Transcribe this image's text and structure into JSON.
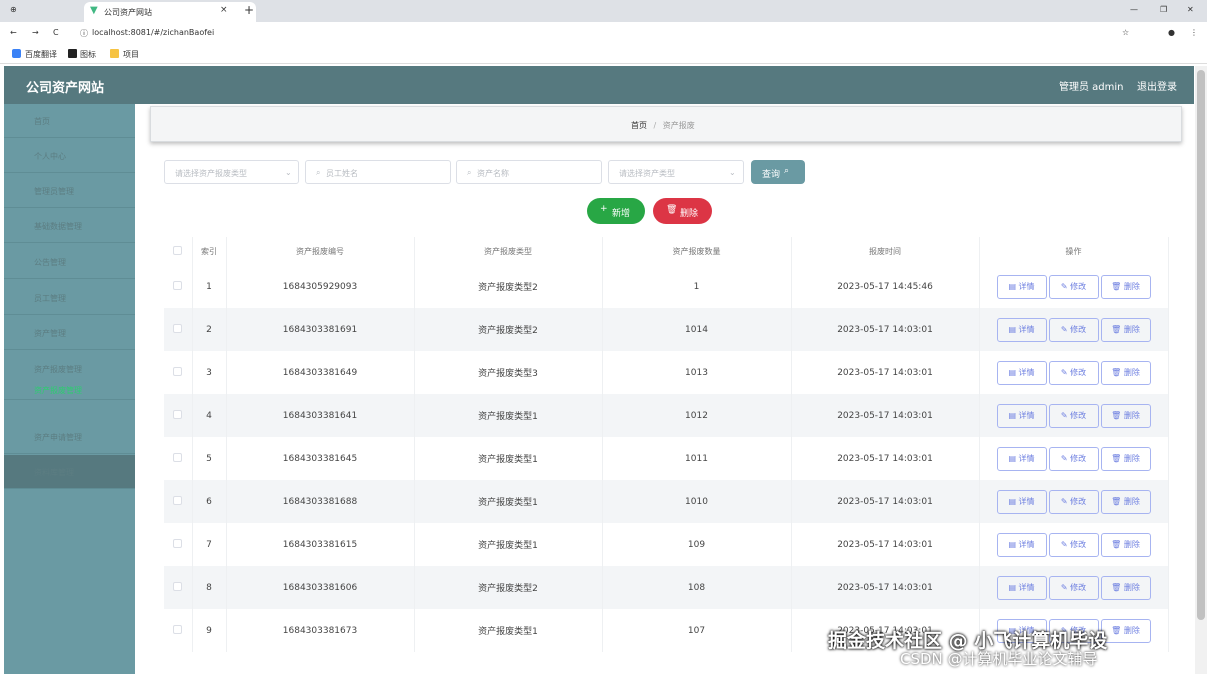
{
  "browser": {
    "tab_title": "公司资产网站",
    "url": "localhost:8081/#/zichanBaofei",
    "bookmarks": [
      "百度翻译",
      "图标",
      "项目"
    ]
  },
  "app": {
    "site_title": "公司资产网站",
    "user_label": "管理员 admin",
    "logout_label": "退出登录"
  },
  "sidebar": {
    "items": [
      "首页",
      "个人中心",
      "管理员管理",
      "基础数据管理",
      "公告管理",
      "员工管理",
      "资产管理",
      "资产报废管理",
      "资产报废管理",
      "资产申请管理",
      "资料库管理"
    ]
  },
  "breadcrumb": {
    "home": "首页",
    "sep": "/",
    "current": "资产报废"
  },
  "filters": {
    "type_placeholder": "请选择资产报废类型",
    "staff_placeholder": "员工姓名",
    "asset_placeholder": "资产名称",
    "asset_type_placeholder": "请选择资产类型",
    "search_label": "查询"
  },
  "actions": {
    "add_label": "新增",
    "delete_label": "删除"
  },
  "table": {
    "headers": [
      "索引",
      "资产报废编号",
      "资产报废类型",
      "资产报废数量",
      "报废时间",
      "操作"
    ],
    "row_actions": {
      "detail": "详情",
      "edit": "修改",
      "delete": "删除"
    },
    "rows": [
      {
        "idx": "1",
        "code": "1684305929093",
        "type": "资产报废类型2",
        "qty": "1",
        "time": "2023-05-17 14:45:46"
      },
      {
        "idx": "2",
        "code": "1684303381691",
        "type": "资产报废类型2",
        "qty": "1014",
        "time": "2023-05-17 14:03:01"
      },
      {
        "idx": "3",
        "code": "1684303381649",
        "type": "资产报废类型3",
        "qty": "1013",
        "time": "2023-05-17 14:03:01"
      },
      {
        "idx": "4",
        "code": "1684303381641",
        "type": "资产报废类型1",
        "qty": "1012",
        "time": "2023-05-17 14:03:01"
      },
      {
        "idx": "5",
        "code": "1684303381645",
        "type": "资产报废类型1",
        "qty": "1011",
        "time": "2023-05-17 14:03:01"
      },
      {
        "idx": "6",
        "code": "1684303381688",
        "type": "资产报废类型1",
        "qty": "1010",
        "time": "2023-05-17 14:03:01"
      },
      {
        "idx": "7",
        "code": "1684303381615",
        "type": "资产报废类型1",
        "qty": "109",
        "time": "2023-05-17 14:03:01"
      },
      {
        "idx": "8",
        "code": "1684303381606",
        "type": "资产报废类型2",
        "qty": "108",
        "time": "2023-05-17 14:03:01"
      },
      {
        "idx": "9",
        "code": "1684303381673",
        "type": "资产报废类型1",
        "qty": "107",
        "time": "2023-05-17 14:03:01"
      }
    ]
  },
  "watermark": {
    "line1": "掘金技术社区 @ 小飞计算机毕设",
    "line2": "CSDN @计算机毕业论文辅导"
  },
  "colors": {
    "nav": "#56797f",
    "sidebar": "#6a9aa3",
    "search": "#6a9aa3",
    "add": "#28a745",
    "delete": "#dc3545"
  }
}
